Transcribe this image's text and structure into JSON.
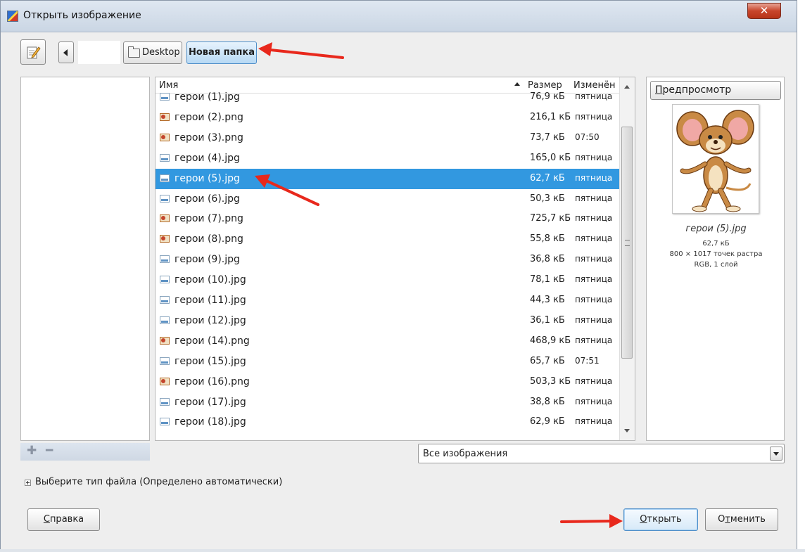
{
  "window": {
    "title": "Открыть изображение"
  },
  "path_bar": {
    "segments": [
      "Desktop",
      "Новая папка"
    ],
    "active_segment": "Новая папка"
  },
  "file_list": {
    "columns": {
      "name": "Имя",
      "size": "Размер",
      "modified": "Изменён"
    },
    "sorted_by": "name",
    "selected_index": 4,
    "rows": [
      {
        "name": "герои (1).jpg",
        "type": "jpg",
        "size": "76,9 кБ",
        "modified": "пятница"
      },
      {
        "name": "герои (2).png",
        "type": "png",
        "size": "216,1 кБ",
        "modified": "пятница"
      },
      {
        "name": "герои (3).png",
        "type": "png",
        "size": "73,7 кБ",
        "modified": "07:50"
      },
      {
        "name": "герои (4).jpg",
        "type": "jpg",
        "size": "165,0 кБ",
        "modified": "пятница"
      },
      {
        "name": "герои (5).jpg",
        "type": "jpg",
        "size": "62,7 кБ",
        "modified": "пятница"
      },
      {
        "name": "герои (6).jpg",
        "type": "jpg",
        "size": "50,3 кБ",
        "modified": "пятница"
      },
      {
        "name": "герои (7).png",
        "type": "png",
        "size": "725,7 кБ",
        "modified": "пятница"
      },
      {
        "name": "герои (8).png",
        "type": "png",
        "size": "55,8 кБ",
        "modified": "пятница"
      },
      {
        "name": "герои (9).jpg",
        "type": "jpg",
        "size": "36,8 кБ",
        "modified": "пятница"
      },
      {
        "name": "герои (10).jpg",
        "type": "jpg",
        "size": "78,1 кБ",
        "modified": "пятница"
      },
      {
        "name": "герои (11).jpg",
        "type": "jpg",
        "size": "44,3 кБ",
        "modified": "пятница"
      },
      {
        "name": "герои (12).jpg",
        "type": "jpg",
        "size": "36,1 кБ",
        "modified": "пятница"
      },
      {
        "name": "герои (14).png",
        "type": "png",
        "size": "468,9 кБ",
        "modified": "пятница"
      },
      {
        "name": "герои (15).jpg",
        "type": "jpg",
        "size": "65,7 кБ",
        "modified": "07:51"
      },
      {
        "name": "герои (16).png",
        "type": "png",
        "size": "503,3 кБ",
        "modified": "пятница"
      },
      {
        "name": "герои (17).jpg",
        "type": "jpg",
        "size": "38,8 кБ",
        "modified": "пятница"
      },
      {
        "name": "герои (18).jpg",
        "type": "jpg",
        "size": "62,9 кБ",
        "modified": "пятница"
      }
    ]
  },
  "preview": {
    "button_label": "Предпросмотр",
    "file_name": "герои (5).jpg",
    "file_size": "62,7 кБ",
    "dimensions": "800 × 1017 точек растра",
    "mode": "RGB, 1 слой"
  },
  "filter": {
    "selected": "Все изображения"
  },
  "file_type": {
    "label": "Выберите тип файла (Определено автоматически)"
  },
  "buttons": {
    "help": "Справка",
    "open": "Открыть",
    "cancel": "Отменить"
  },
  "colors": {
    "selection": "#3298e0",
    "annotation_arrow": "#e8281c",
    "active_path": "#b7d9f4"
  },
  "icons": {
    "app": "gimp-icon",
    "close": "close-icon",
    "edit": "edit-pencil-icon",
    "back": "chevron-left-icon",
    "folder": "folder-icon",
    "jpg": "image-jpg-icon",
    "png": "image-png-icon",
    "add": "plus-icon",
    "remove": "minus-icon"
  }
}
